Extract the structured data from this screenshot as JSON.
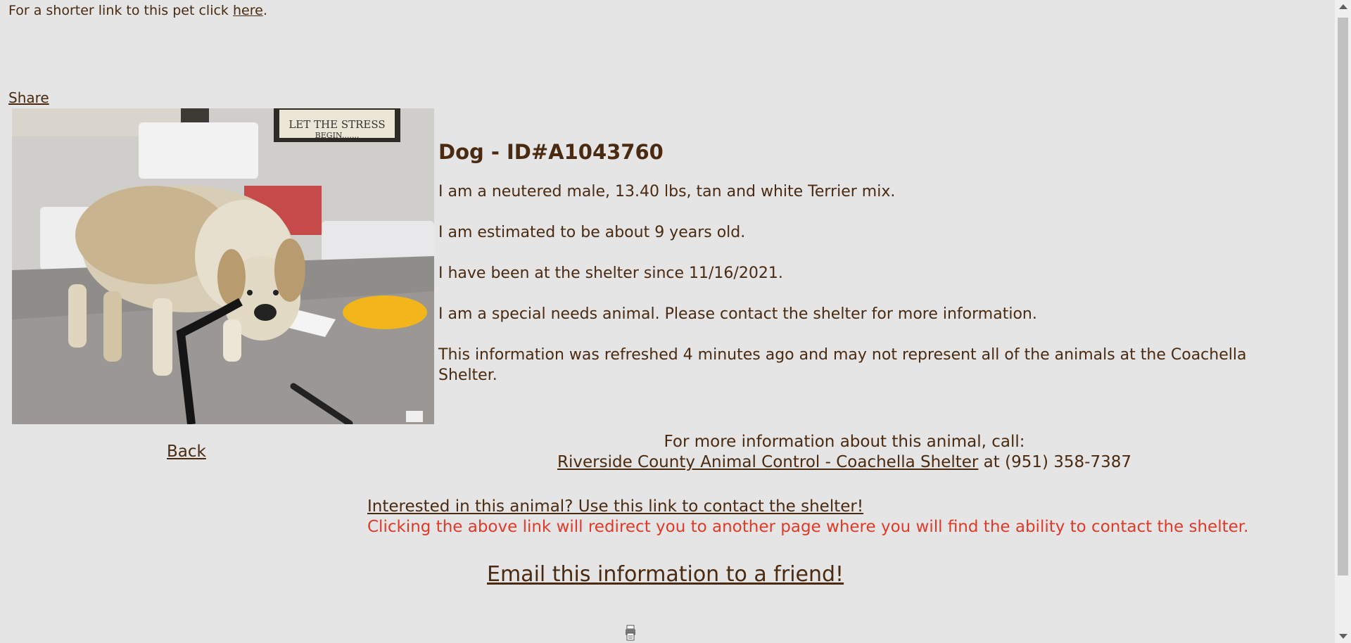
{
  "header": {
    "shorter_link_text": "For a shorter link to this pet click ",
    "here_link": "here",
    "period": "."
  },
  "share_label": "Share",
  "photo": {
    "alt": "Tan and white Terrier mix dog standing on a steel exam table"
  },
  "animal": {
    "title": "Dog - ID#A1043760",
    "description": "I am a neutered male, 13.40 lbs, tan and white Terrier mix.",
    "age": "I am estimated to be about 9 years old.",
    "since": "I have been at the shelter since 11/16/2021.",
    "special_needs": "I am a special needs animal. Please contact the shelter for more information.",
    "refreshed": "This information was refreshed 4 minutes ago and may not represent all of the animals at the Coachella Shelter."
  },
  "back_label": "Back",
  "call": {
    "intro": "For more information about this animal, call:",
    "shelter_link": "Riverside County Animal Control - Coachella Shelter",
    "phone_text": " at (951) 358-7387"
  },
  "contact": {
    "link": "Interested in this animal? Use this link to contact the shelter!",
    "note": "Clicking the above link will redirect you to another page where you will find the ability to contact the shelter."
  },
  "email_label": "Email this information to a friend!",
  "colors": {
    "background": "#e5e5e5",
    "text": "#4a2a10",
    "warning": "#e03a2a"
  }
}
